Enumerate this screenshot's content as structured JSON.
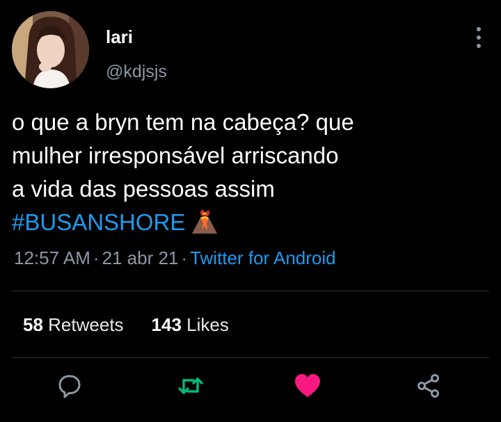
{
  "user": {
    "display_name": "lari",
    "handle": "@kdjsjs",
    "avatar_icon": "profile-photo"
  },
  "tweet": {
    "lines": [
      "o que a bryn tem na cabeça? que",
      "mulher irresponsável arriscando",
      "a vida das pessoas assim"
    ],
    "hashtag": "#BUSANSHORE",
    "emoji_icon": "volcano-emoji"
  },
  "meta": {
    "time": "12:57 AM",
    "separator": "·",
    "date": "21 abr 21",
    "source": "Twitter for Android"
  },
  "stats": {
    "retweets_count": "58",
    "retweets_label": "Retweets",
    "likes_count": "143",
    "likes_label": "Likes"
  },
  "actions": [
    {
      "name": "reply",
      "icon": "reply-icon"
    },
    {
      "name": "retweet",
      "icon": "retweet-icon",
      "active": true
    },
    {
      "name": "like",
      "icon": "heart-icon",
      "active": true
    },
    {
      "name": "share",
      "icon": "share-icon"
    }
  ],
  "colors": {
    "background": "#000000",
    "accent": "#1d9bf0",
    "secondary_text": "#8b98a5",
    "retweet_active": "#00ba7c",
    "like_active": "#f91880",
    "divider": "#2f3336"
  },
  "more_menu_icon": "vertical-ellipsis-icon"
}
